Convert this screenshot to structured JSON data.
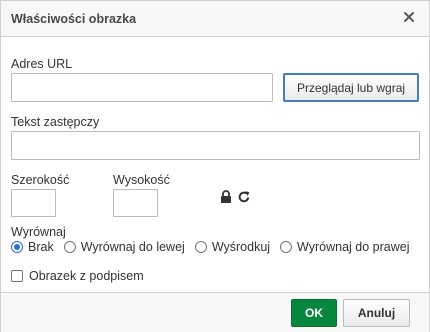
{
  "dialog": {
    "title": "Właściwości obrazka",
    "close_icon": "close-icon"
  },
  "url": {
    "label": "Adres URL",
    "value": "",
    "browse_label": "Przeglądaj lub wgraj"
  },
  "alt": {
    "label": "Tekst zastępczy",
    "value": ""
  },
  "size": {
    "width_label": "Szerokość",
    "width_value": "",
    "height_label": "Wysokość",
    "height_value": "",
    "lock_icon": "lock-icon",
    "reset_icon": "reset-icon"
  },
  "alignment": {
    "label": "Wyrównaj",
    "options": [
      {
        "label": "Brak",
        "checked": true
      },
      {
        "label": "Wyrównaj do lewej",
        "checked": false
      },
      {
        "label": "Wyśrodkuj",
        "checked": false
      },
      {
        "label": "Wyrównaj do prawej",
        "checked": false
      }
    ]
  },
  "caption": {
    "label": "Obrazek z podpisem",
    "checked": false
  },
  "footer": {
    "ok_label": "OK",
    "cancel_label": "Anuluj"
  },
  "colors": {
    "ok_green": "#09863e",
    "focus_blue": "#427ec6"
  }
}
